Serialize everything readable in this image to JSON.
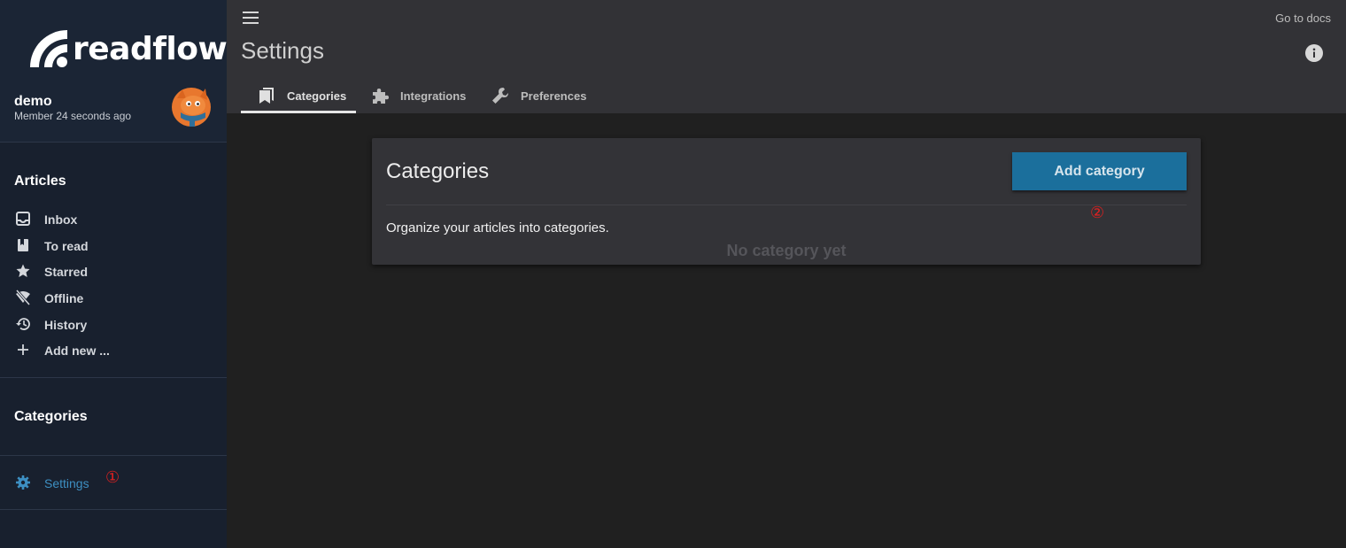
{
  "app": {
    "brand": "readflow"
  },
  "user": {
    "name": "demo",
    "since": "Member 24 seconds ago"
  },
  "sidebar": {
    "articles_title": "Articles",
    "items": [
      {
        "label": "Inbox",
        "icon": "inbox-icon"
      },
      {
        "label": "To read",
        "icon": "bookmark-icon"
      },
      {
        "label": "Starred",
        "icon": "star-icon"
      },
      {
        "label": "Offline",
        "icon": "wifi-off-icon"
      },
      {
        "label": "History",
        "icon": "history-icon"
      },
      {
        "label": "Add new ...",
        "icon": "plus-icon"
      }
    ],
    "categories_title": "Categories",
    "settings_label": "Settings",
    "settings_marker": "①"
  },
  "header": {
    "title": "Settings",
    "docs_link": "Go to docs",
    "tabs": [
      {
        "label": "Categories",
        "icon": "bookmarks-icon",
        "active": true
      },
      {
        "label": "Integrations",
        "icon": "puzzle-icon",
        "active": false
      },
      {
        "label": "Preferences",
        "icon": "wrench-icon",
        "active": false
      }
    ]
  },
  "card": {
    "title": "Categories",
    "add_button": "Add category",
    "add_marker": "②",
    "description": "Organize your articles into categories.",
    "empty_text": "No category yet"
  },
  "colors": {
    "sidebar_bg": "#18202e",
    "topbar_bg": "#323236",
    "content_bg": "#202020",
    "accent": "#1b6f9c",
    "settings_link": "#3d8fc2",
    "marker": "#e02020"
  }
}
